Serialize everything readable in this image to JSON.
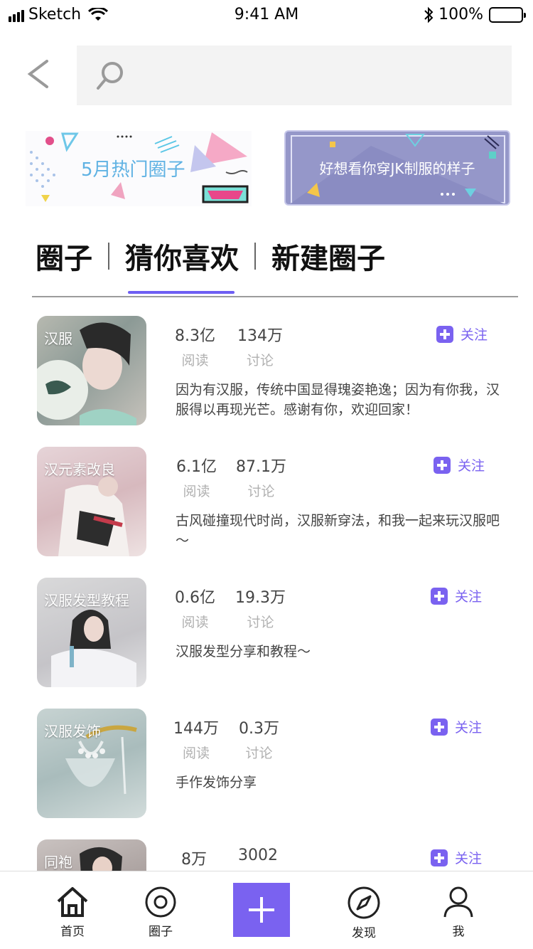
{
  "status_bar": {
    "carrier": "Sketch",
    "time": "9:41 AM",
    "battery": "100%"
  },
  "search": {
    "placeholder": ""
  },
  "banners": [
    {
      "text": "5月热门圈子"
    },
    {
      "text": "好想看你穿JK制服的样子"
    }
  ],
  "tabs": [
    {
      "label": "圈子",
      "active": false
    },
    {
      "label": "猜你喜欢",
      "active": true
    },
    {
      "label": "新建圈子",
      "active": false
    }
  ],
  "read_label": "阅读",
  "discuss_label": "讨论",
  "follow_label": "关注",
  "circles": [
    {
      "name": "汉服",
      "reads": "8.3亿",
      "discussions": "134万",
      "description": "因为有汉服，传统中国显得瑰姿艳逸；因为有你我，汉服得以再现光芒。感谢有你，欢迎回家！"
    },
    {
      "name": "汉元素改良",
      "reads": "6.1亿",
      "discussions": "87.1万",
      "description": "古风碰撞现代时尚，汉服新穿法，和我一起来玩汉服吧～"
    },
    {
      "name": "汉服发型教程",
      "reads": "0.6亿",
      "discussions": "19.3万",
      "description": "汉服发型分享和教程～"
    },
    {
      "name": "汉服发饰",
      "reads": "144万",
      "discussions": "0.3万",
      "description": "手作发饰分享"
    },
    {
      "name": "同袍",
      "reads": "8万",
      "discussions": "3002",
      "description": ""
    }
  ],
  "bottom_nav": {
    "home": "首页",
    "circle": "圈子",
    "discover": "发现",
    "me": "我"
  },
  "colors": {
    "accent": "#7a62f0"
  }
}
